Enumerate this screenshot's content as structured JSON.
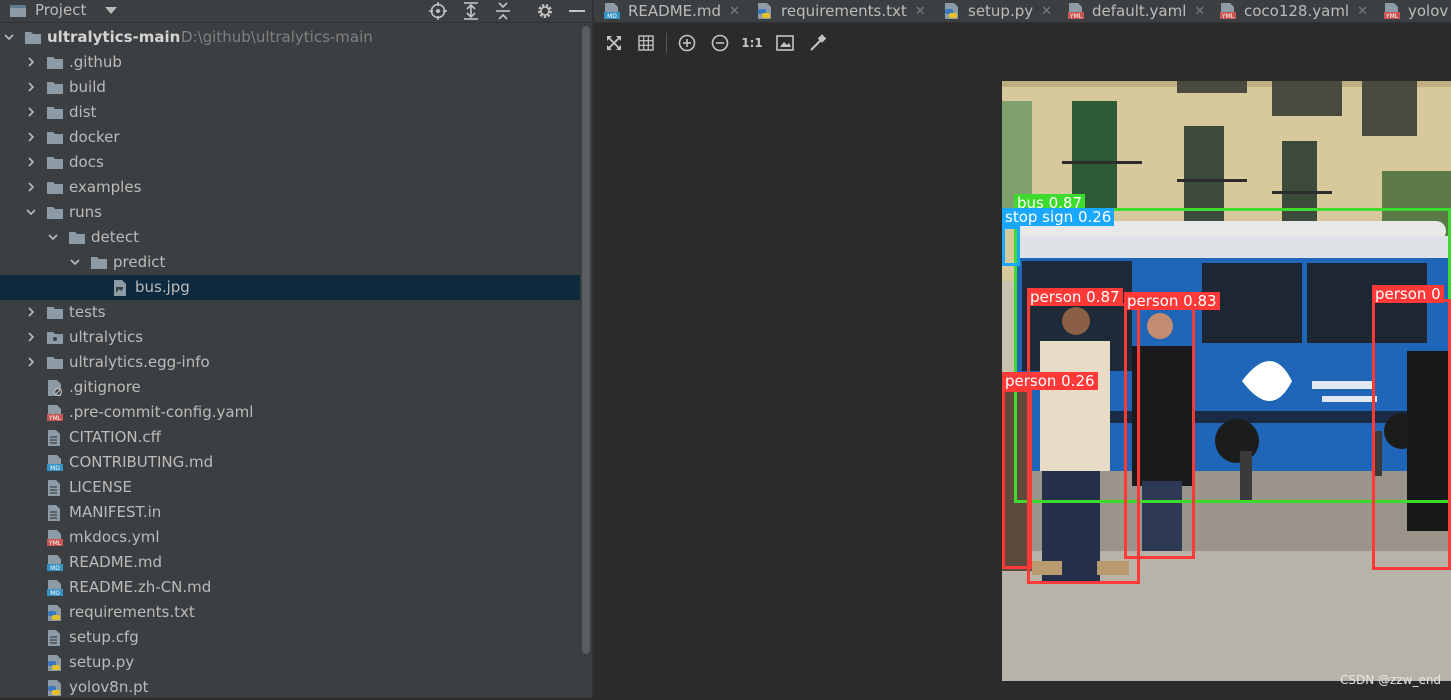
{
  "panel": {
    "title": "Project",
    "icons": [
      "folder-icon",
      "dropdown-icon",
      "locate-icon",
      "expand-all-icon",
      "collapse-all-icon",
      "gear-icon",
      "minimize-icon"
    ]
  },
  "tree": [
    {
      "name": "ultralytics-main",
      "hint": "D:\\github\\ultralytics-main",
      "type": "folder",
      "depth": 0,
      "expanded": true,
      "root": true
    },
    {
      "name": ".github",
      "type": "folder",
      "depth": 1,
      "expanded": false
    },
    {
      "name": "build",
      "type": "folder",
      "depth": 1,
      "expanded": false
    },
    {
      "name": "dist",
      "type": "folder",
      "depth": 1,
      "expanded": false
    },
    {
      "name": "docker",
      "type": "folder",
      "depth": 1,
      "expanded": false
    },
    {
      "name": "docs",
      "type": "folder",
      "depth": 1,
      "expanded": false
    },
    {
      "name": "examples",
      "type": "folder",
      "depth": 1,
      "expanded": false
    },
    {
      "name": "runs",
      "type": "folder",
      "depth": 1,
      "expanded": true
    },
    {
      "name": "detect",
      "type": "folder",
      "depth": 2,
      "expanded": true
    },
    {
      "name": "predict",
      "type": "folder",
      "depth": 3,
      "expanded": true
    },
    {
      "name": "bus.jpg",
      "type": "image",
      "depth": 4,
      "selected": true
    },
    {
      "name": "tests",
      "type": "folder",
      "depth": 1,
      "expanded": false
    },
    {
      "name": "ultralytics",
      "type": "package",
      "depth": 1,
      "expanded": false
    },
    {
      "name": "ultralytics.egg-info",
      "type": "folder",
      "depth": 1,
      "expanded": false
    },
    {
      "name": ".gitignore",
      "type": "ignore",
      "depth": 1
    },
    {
      "name": ".pre-commit-config.yaml",
      "type": "yaml",
      "depth": 1
    },
    {
      "name": "CITATION.cff",
      "type": "text",
      "depth": 1
    },
    {
      "name": "CONTRIBUTING.md",
      "type": "md",
      "depth": 1
    },
    {
      "name": "LICENSE",
      "type": "text",
      "depth": 1
    },
    {
      "name": "MANIFEST.in",
      "type": "text",
      "depth": 1
    },
    {
      "name": "mkdocs.yml",
      "type": "yaml",
      "depth": 1
    },
    {
      "name": "README.md",
      "type": "md",
      "depth": 1
    },
    {
      "name": "README.zh-CN.md",
      "type": "md",
      "depth": 1
    },
    {
      "name": "requirements.txt",
      "type": "python-txt",
      "depth": 1
    },
    {
      "name": "setup.cfg",
      "type": "text",
      "depth": 1
    },
    {
      "name": "setup.py",
      "type": "python",
      "depth": 1
    },
    {
      "name": "yolov8n.pt",
      "type": "python",
      "depth": 1
    }
  ],
  "tabs": [
    {
      "label": "README.md",
      "type": "md"
    },
    {
      "label": "requirements.txt",
      "type": "python-txt"
    },
    {
      "label": "setup.py",
      "type": "python"
    },
    {
      "label": "default.yaml",
      "type": "yaml"
    },
    {
      "label": "coco128.yaml",
      "type": "yaml"
    },
    {
      "label": "yolov",
      "type": "yaml"
    }
  ],
  "toolbar": {
    "buttons": [
      "fit-icon",
      "grid-icon",
      "zoom-in-icon",
      "zoom-out-icon",
      "actual-size-text",
      "background-icon",
      "color-picker-icon"
    ],
    "actual_size_label": "1:1"
  },
  "image": {
    "file": "bus.jpg",
    "detections": [
      {
        "label": "bus 0.87",
        "color": "#3ddb2b"
      },
      {
        "label": "stop sign 0.26",
        "color": "#1aa7ff"
      },
      {
        "label": "person 0.87",
        "color": "#ff3838"
      },
      {
        "label": "person 0.83",
        "color": "#ff3838"
      },
      {
        "label": "person 0",
        "color": "#ff3838"
      },
      {
        "label": "person 0.26",
        "color": "#ff3838"
      }
    ]
  },
  "watermark": "CSDN @zzw_end",
  "colors": {
    "panel_bg": "#3c3f41",
    "editor_bg": "#2b2b2b",
    "selection": "#0d293e",
    "folder": "#8c9ba5",
    "yaml": "#c75450",
    "md": "#3592c4"
  }
}
